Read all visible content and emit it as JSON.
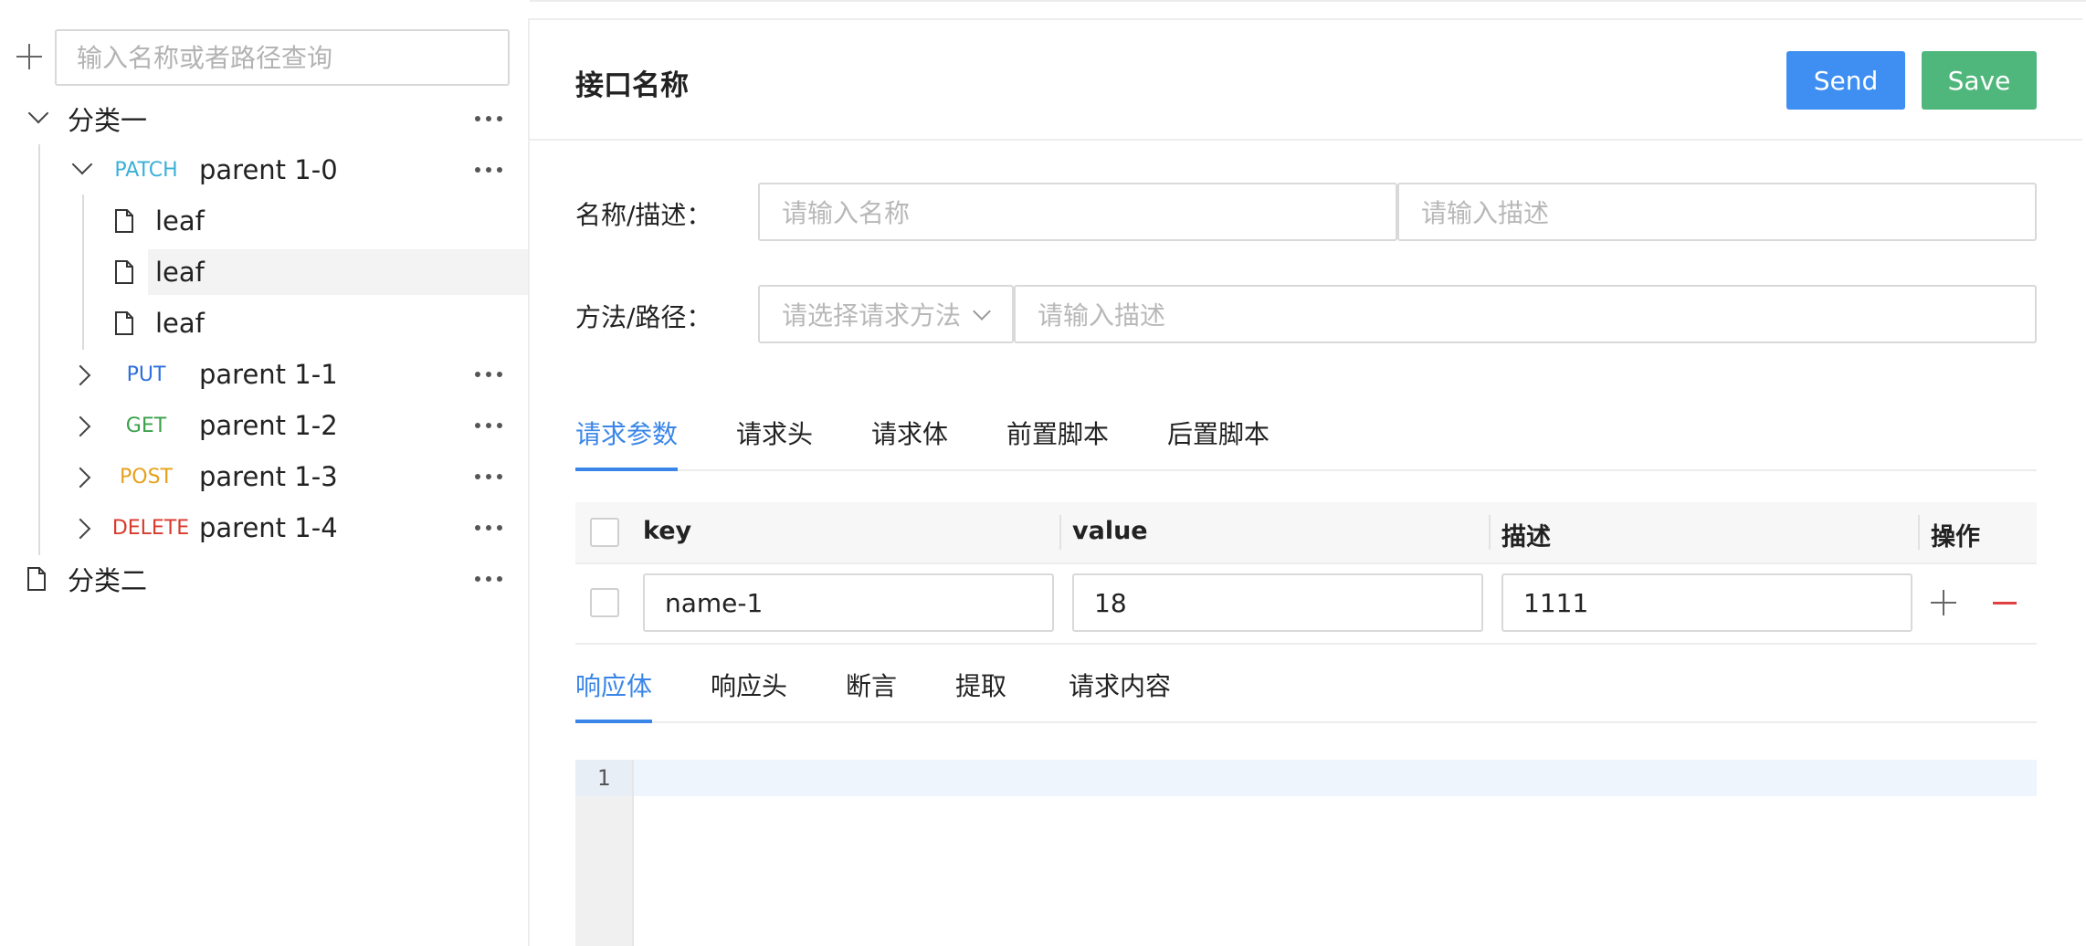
{
  "sidebar": {
    "search_placeholder": "输入名称或者路径查询",
    "categories": [
      {
        "label": "分类一"
      },
      {
        "label": "分类二"
      }
    ],
    "parents": [
      {
        "method": "PATCH",
        "method_color": "#3ab0d8",
        "label": "parent 1-0"
      },
      {
        "method": "PUT",
        "method_color": "#2f6fdb",
        "label": "parent 1-1"
      },
      {
        "method": "GET",
        "method_color": "#3aa14b",
        "label": "parent 1-2"
      },
      {
        "method": "POST",
        "method_color": "#e6a11b",
        "label": "parent 1-3"
      },
      {
        "method": "DELETE",
        "method_color": "#d83a2e",
        "label": "parent 1-4"
      }
    ],
    "leaves": [
      {
        "label": "leaf"
      },
      {
        "label": "leaf"
      },
      {
        "label": "leaf"
      }
    ]
  },
  "main": {
    "title": "接口名称",
    "send_label": "Send",
    "save_label": "Save",
    "name_desc_label": "名称/描述：",
    "name_placeholder": "请输入名称",
    "desc_placeholder": "请输入描述",
    "method_path_label": "方法/路径：",
    "method_placeholder": "请选择请求方法",
    "path_placeholder": "请输入描述",
    "request_tabs": [
      "请求参数",
      "请求头",
      "请求体",
      "前置脚本",
      "后置脚本"
    ],
    "table": {
      "headers": [
        "key",
        "value",
        "描述",
        "操作"
      ],
      "rows": [
        {
          "key": "name-1",
          "value": "18",
          "desc": "1111"
        }
      ]
    },
    "response_tabs": [
      "响应体",
      "响应头",
      "断言",
      "提取",
      "请求内容"
    ],
    "editor_line": "1"
  },
  "colors": {
    "accent": "#3a86e8",
    "send": "#3f8ef1",
    "save": "#4fb77c",
    "remove": "#e04040"
  }
}
